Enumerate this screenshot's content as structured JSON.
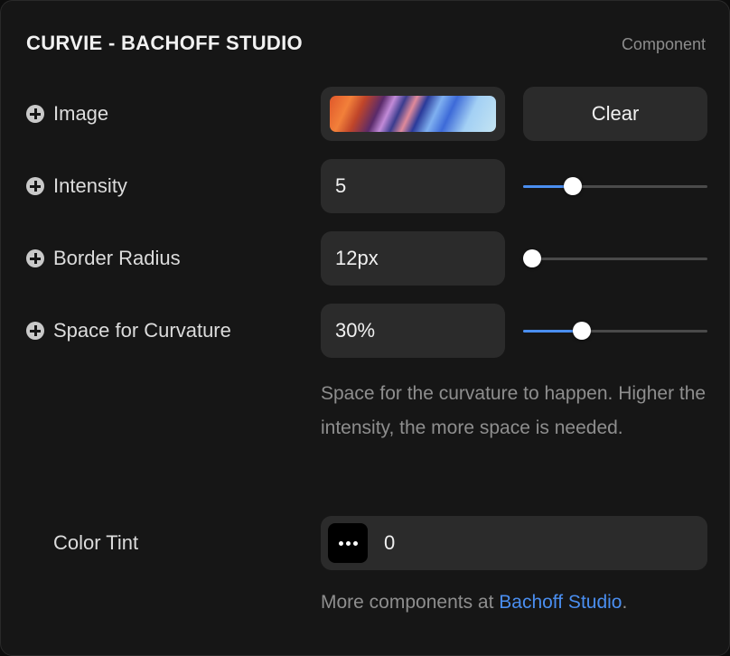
{
  "header": {
    "title": "CURVIE - BACHOFF STUDIO",
    "subtitle": "Component"
  },
  "rows": {
    "image": {
      "label": "Image",
      "clear_label": "Clear"
    },
    "intensity": {
      "label": "Intensity",
      "value": "5",
      "slider_fraction": 0.27
    },
    "border_radius": {
      "label": "Border Radius",
      "value": "12px",
      "slider_fraction": 0.05
    },
    "space": {
      "label": "Space for Curvature",
      "value": "30%",
      "slider_fraction": 0.32
    }
  },
  "description": "Space for the curvature to happen. Higher the intensity, the more space is needed.",
  "color_tint": {
    "label": "Color Tint",
    "value": "0"
  },
  "footer": {
    "prefix": "More components at ",
    "link": "Bachoff Studio",
    "suffix": "."
  },
  "colors": {
    "accent": "#4a8ef0",
    "panel": "#161616",
    "field": "#2b2b2b"
  },
  "icons": [
    "plus-circle-icon",
    "more-dots-icon"
  ]
}
